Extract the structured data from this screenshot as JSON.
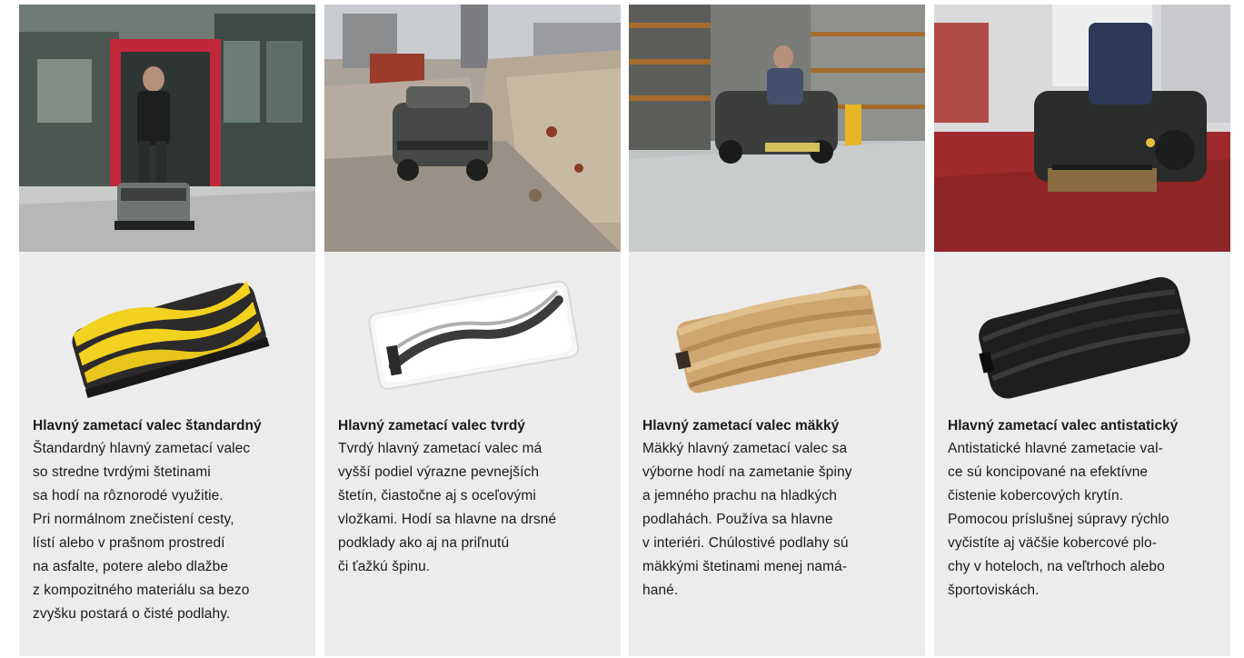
{
  "cards": [
    {
      "scene_photo": "street-sweeper-photo",
      "product_photo": "yellow-standard-roller",
      "title": "Hlavný zametací valec štandardný",
      "lines": [
        "Štandardný hlavný zametací valec",
        "so stredne tvrdými štetinami",
        "sa hodí na rôznorodé využitie.",
        "Pri normálnom znečistení cesty,",
        "lístí alebo v prašnom prostredí",
        "na asfalte, potere alebo dlažbe",
        "z kompozitného materiálu sa bezo",
        "zvyšku postará o čisté podlahy."
      ]
    },
    {
      "scene_photo": "construction-site-photo",
      "product_photo": "clear-hard-roller",
      "title": "Hlavný zametací valec tvrdý",
      "lines": [
        "Tvrdý hlavný zametací valec má",
        "vyšší podiel výrazne pevnejších",
        "štetín, čiastočne aj s oceľovými",
        "vložkami. Hodí sa hlavne na drsné",
        "podklady ako aj na priľnutú",
        "či ťažkú špinu."
      ]
    },
    {
      "scene_photo": "warehouse-photo",
      "product_photo": "natural-soft-roller",
      "title": "Hlavný zametací valec mäkký",
      "lines": [
        "Mäkký hlavný zametací valec sa",
        "výborne hodí na zametanie špiny",
        "a jemného prachu na hladkých",
        "podlahách. Používa sa hlavne",
        "v interiéri. Chúlostivé podlahy sú",
        "mäkkými štetinami menej namá-",
        "hané."
      ]
    },
    {
      "scene_photo": "carpet-hall-photo",
      "product_photo": "black-antistatic-roller",
      "title": "Hlavný zametací valec antistatický",
      "lines": [
        "Antistatické hlavné zametacie val-",
        "ce sú koncipované na efektívne",
        "čistenie kobercových krytín.",
        "Pomocou príslušnej súpravy rýchlo",
        "vyčistíte aj väčšie kobercové plo-",
        "chy v hoteloch, na veľtrhoch alebo",
        "športoviskách."
      ]
    }
  ]
}
